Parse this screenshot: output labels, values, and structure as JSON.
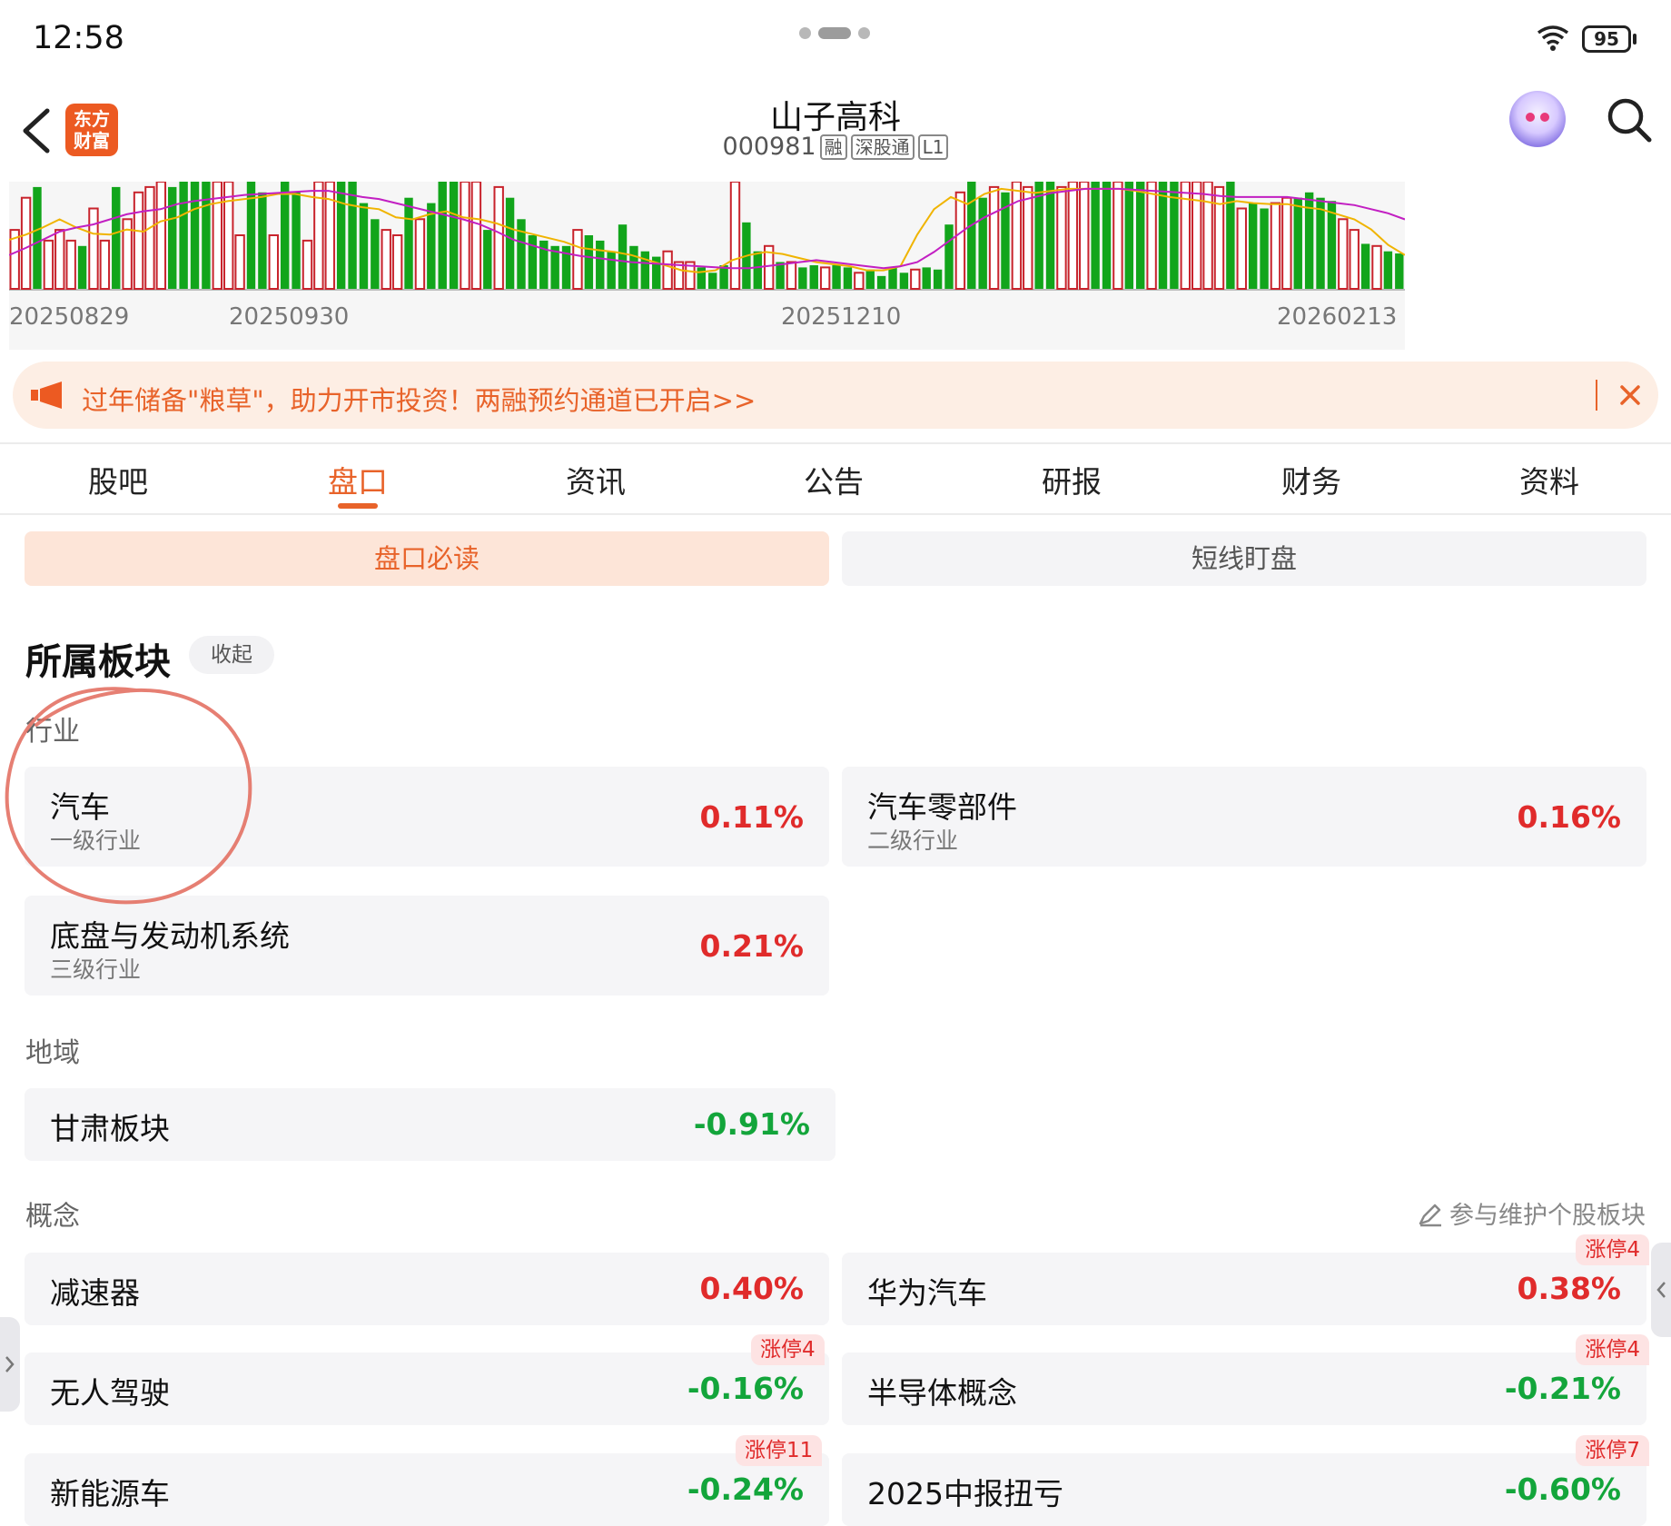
{
  "status_bar": {
    "time": "12:58",
    "battery": "95"
  },
  "header": {
    "logo_line1": "东方",
    "logo_line2": "财富",
    "stock_name": "山子高科",
    "stock_code": "000981",
    "tags": [
      "融",
      "深股通",
      "L1"
    ]
  },
  "chart": {
    "x_tick_labels": [
      "20250829",
      "20250930",
      "20251210",
      "20260213"
    ],
    "colors": {
      "up": "#c8232c",
      "down": "#12a51b",
      "ma_yellow": "#f0b400",
      "ma_purple": "#c21fc2"
    }
  },
  "chart_data": {
    "type": "bar",
    "categories_sample": [
      "20250829",
      "20250930",
      "20251210",
      "20260213"
    ],
    "values": [
      0.55,
      0.85,
      0.95,
      0.45,
      0.55,
      0.45,
      0.4,
      0.75,
      0.45,
      0.95,
      0.65,
      0.9,
      0.95,
      1,
      0.95,
      1,
      1,
      1,
      1,
      1,
      0.5,
      1,
      0.9,
      0.5,
      1,
      0.9,
      0.45,
      1,
      1,
      1,
      1,
      0.8,
      0.65,
      0.55,
      0.5,
      0.85,
      0.65,
      0.8,
      1,
      1,
      1,
      1,
      0.55,
      0.95,
      0.85,
      0.65,
      0.5,
      0.45,
      0.4,
      0.4,
      0.55,
      0.5,
      0.45,
      0.35,
      0.6,
      0.4,
      0.35,
      0.3,
      0.35,
      0.25,
      0.25,
      0.2,
      0.15,
      0.22,
      1,
      0.62,
      0.35,
      0.4,
      0.25,
      0.25,
      0.2,
      0.22,
      0.2,
      0.22,
      0.2,
      0.15,
      0.18,
      0.12,
      0.2,
      0.15,
      0.18,
      0.2,
      0.18,
      0.6,
      0.9,
      1,
      0.85,
      0.95,
      0.9,
      1,
      0.95,
      1,
      1,
      0.95,
      1,
      1,
      1,
      1,
      1,
      1,
      1,
      1,
      1,
      1,
      1,
      1,
      1,
      0.95,
      1,
      0.75,
      0.8,
      0.75,
      0.8,
      0.85,
      0.85,
      0.9,
      0.85,
      0.82,
      0.65,
      0.55,
      0.42,
      0.4,
      0.35,
      0.33
    ],
    "up_flags": [
      1,
      1,
      0,
      1,
      1,
      1,
      0,
      1,
      1,
      0,
      1,
      1,
      1,
      1,
      0,
      0,
      0,
      0,
      1,
      1,
      1,
      0,
      0,
      1,
      0,
      0,
      1,
      1,
      1,
      0,
      0,
      0,
      0,
      1,
      1,
      0,
      1,
      0,
      0,
      0,
      1,
      1,
      0,
      1,
      0,
      0,
      0,
      0,
      0,
      0,
      1,
      0,
      0,
      0,
      0,
      0,
      0,
      0,
      1,
      1,
      1,
      0,
      0,
      0,
      1,
      0,
      0,
      1,
      0,
      1,
      0,
      0,
      1,
      0,
      0,
      1,
      0,
      0,
      0,
      0,
      1,
      0,
      0,
      0,
      1,
      0,
      0,
      1,
      0,
      1,
      1,
      0,
      0,
      1,
      1,
      1,
      0,
      0,
      1,
      0,
      0,
      1,
      0,
      0,
      1,
      1,
      1,
      1,
      0,
      1,
      0,
      0,
      1,
      1,
      0,
      0,
      0,
      0,
      1,
      1,
      0,
      1
    ],
    "ma_yellow": [
      0.5,
      0.55,
      0.62,
      0.7,
      0.62,
      0.56,
      0.55,
      0.6,
      0.58,
      0.68,
      0.72,
      0.8,
      0.85,
      0.88,
      0.9,
      0.92,
      0.95,
      0.95,
      0.92,
      0.9,
      0.85,
      0.82,
      0.8,
      0.72,
      0.7,
      0.75,
      0.78,
      0.72,
      0.7,
      0.66,
      0.6,
      0.56,
      0.52,
      0.48,
      0.42,
      0.4,
      0.38,
      0.35,
      0.3,
      0.25,
      0.2,
      0.18,
      0.2,
      0.3,
      0.35,
      0.38,
      0.36,
      0.32,
      0.28,
      0.26,
      0.24,
      0.2,
      0.2,
      0.24,
      0.55,
      0.8,
      0.92,
      0.85,
      0.95,
      1,
      0.98,
      0.96,
      0.98,
      1,
      1,
      1,
      1,
      0.98,
      0.95,
      0.92,
      0.9,
      0.88,
      0.85,
      0.88,
      0.86,
      0.85,
      0.85,
      0.82,
      0.8,
      0.75,
      0.7,
      0.6,
      0.45,
      0.35
    ],
    "ma_purple": [
      0.35,
      0.42,
      0.5,
      0.58,
      0.62,
      0.65,
      0.7,
      0.75,
      0.78,
      0.8,
      0.85,
      0.88,
      0.9,
      0.92,
      0.94,
      0.95,
      0.96,
      0.97,
      0.98,
      0.98,
      0.95,
      0.92,
      0.9,
      0.86,
      0.82,
      0.78,
      0.74,
      0.7,
      0.65,
      0.58,
      0.5,
      0.45,
      0.4,
      0.37,
      0.34,
      0.32,
      0.3,
      0.28,
      0.27,
      0.26,
      0.25,
      0.24,
      0.23,
      0.22,
      0.22,
      0.24,
      0.26,
      0.28,
      0.3,
      0.28,
      0.26,
      0.24,
      0.22,
      0.24,
      0.28,
      0.38,
      0.5,
      0.62,
      0.72,
      0.8,
      0.88,
      0.92,
      0.96,
      0.98,
      1,
      1,
      1,
      0.99,
      0.98,
      0.97,
      0.96,
      0.95,
      0.93,
      0.92,
      0.92,
      0.92,
      0.92,
      0.9,
      0.88,
      0.86,
      0.84,
      0.8,
      0.76,
      0.7
    ],
    "xlabel": "",
    "ylabel": ""
  },
  "banner": {
    "text": "过年储备\"粮草\"，助力开市投资！两融预约通道已开启>>"
  },
  "tabs": [
    "股吧",
    "盘口",
    "资讯",
    "公告",
    "研报",
    "财务",
    "资料"
  ],
  "segment": {
    "left": "盘口必读",
    "right": "短线盯盘"
  },
  "section": {
    "title": "所属板块",
    "collapse": "收起",
    "industry_label": "行业",
    "industry": [
      {
        "name": "汽车",
        "level": "一级行业",
        "pct": "0.11%"
      },
      {
        "name": "汽车零部件",
        "level": "二级行业",
        "pct": "0.16%"
      },
      {
        "name": "底盘与发动机系统",
        "level": "三级行业",
        "pct": "0.21%"
      }
    ],
    "region_label": "地域",
    "region": [
      {
        "name": "甘肃板块",
        "pct": "-0.91%"
      }
    ],
    "concept_label": "概念",
    "maintain_text": "参与维护个股板块",
    "concept": [
      {
        "name": "减速器",
        "pct": "0.40%",
        "badge": ""
      },
      {
        "name": "华为汽车",
        "pct": "0.38%",
        "badge": "涨停4"
      },
      {
        "name": "无人驾驶",
        "pct": "-0.16%",
        "badge": "涨停4"
      },
      {
        "name": "半导体概念",
        "pct": "-0.21%",
        "badge": "涨停4"
      },
      {
        "name": "新能源车",
        "pct": "-0.24%",
        "badge": "涨停11"
      },
      {
        "name": "2025中报扭亏",
        "pct": "-0.60%",
        "badge": "涨停7"
      }
    ]
  }
}
